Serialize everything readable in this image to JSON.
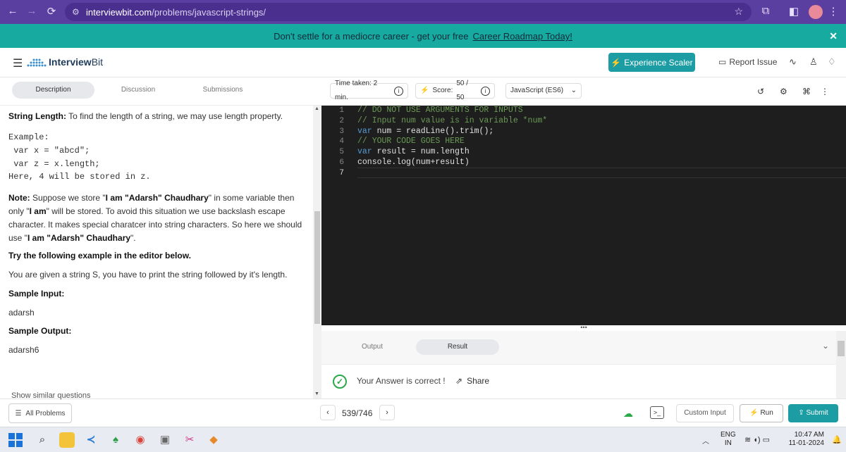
{
  "browser": {
    "url_host": "interviewbit.com",
    "url_path": "/problems/javascript-strings/",
    "back_icon": "←",
    "forward_icon": "→",
    "reload_icon": "⟳"
  },
  "banner": {
    "text": "Don't settle for a mediocre career - get your free",
    "link": "Career Roadmap Today!",
    "close": "✕"
  },
  "header": {
    "logo_inter": "Interview",
    "logo_bit": "Bit",
    "experience_button": "Experience Scaler",
    "report_issue": "Report Issue"
  },
  "tabs": {
    "description": "Description",
    "discussion": "Discussion",
    "submissions": "Submissions"
  },
  "toolbar": {
    "time_taken": "Time taken: 2 min.",
    "score_label": "Score:",
    "score_value": "50 / 50",
    "language": "JavaScript (ES6)"
  },
  "problem": {
    "string_length_label": "String Length:",
    "string_length_text": "To find the length of a string, we may use length property.",
    "example_title": "Example:",
    "example_line1": " var x = \"abcd\";",
    "example_line2": " var z = x.length;",
    "example_line3": "Here, 4 will be stored in z.",
    "note_label": "Note:",
    "note_part1": "Suppose we store \"",
    "note_bold1": "I am \"Adarsh\" Chaudhary",
    "note_part2": "\" in some variable then only \"",
    "note_bold2": "I am",
    "note_part3": "\" will be stored. To avoid this situation we use backslash escape character. It makes special charatcer into string characters. So here we should use \"",
    "note_bold3": "I am \"Adarsh\" Chaudhary",
    "note_part4": "\".",
    "try_text": "Try the following example in the editor below.",
    "task_text": "You are given a string S, you have to print the string followed by it's length.",
    "sample_input_label": "Sample Input:",
    "sample_input": "adarsh",
    "sample_output_label": "Sample Output:",
    "sample_output": "adarsh6",
    "show_similar": "Show similar questions"
  },
  "editor": {
    "line_numbers": [
      "1",
      "2",
      "3",
      "4",
      "5",
      "6",
      "7"
    ],
    "lines": [
      "// DO NOT USE ARGUMENTS FOR INPUTS",
      "// Input num value is in variable *num*",
      "var num = readLine().trim();",
      "// YOUR CODE GOES HERE",
      "var result = num.length",
      "console.log(num+result)",
      ""
    ]
  },
  "result": {
    "output_tab": "Output",
    "result_tab": "Result",
    "message": "Your Answer is correct !",
    "share": "Share"
  },
  "bottom": {
    "all_problems": "All Problems",
    "page": "539/746",
    "custom_input": "Custom Input",
    "run": "Run",
    "submit": "Submit"
  },
  "taskbar": {
    "lang_line1": "ENG",
    "lang_line2": "IN",
    "time": "10:47 AM",
    "date": "11-01-2024"
  },
  "colors": {
    "chrome": "#5b3fa0",
    "banner": "#17aaa0",
    "accent": "#1b9da3",
    "editor_bg": "#1e1e1e",
    "success": "#2aa84a"
  }
}
